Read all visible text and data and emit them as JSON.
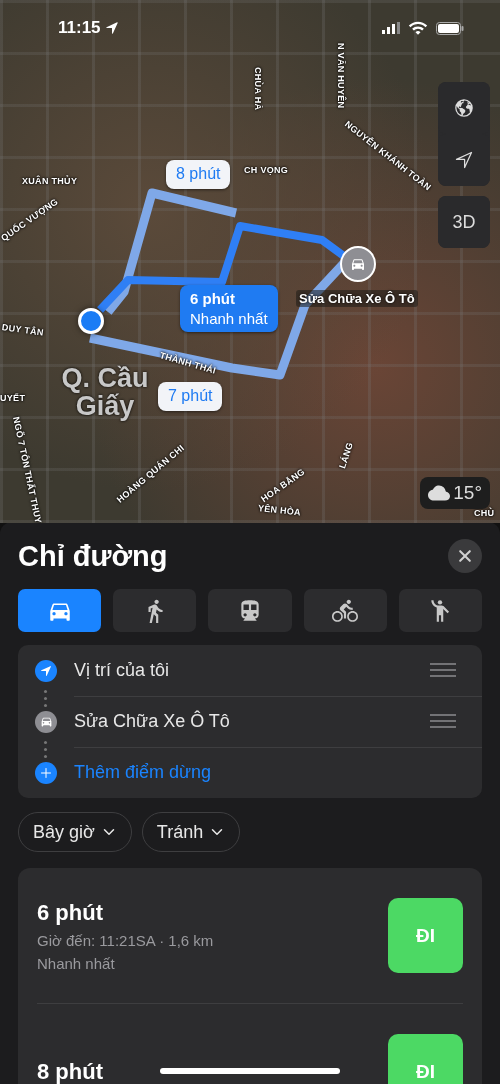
{
  "status_bar": {
    "time": "11:15"
  },
  "map": {
    "labels": [
      {
        "kind": "street",
        "text": "XUÂN THỦY"
      },
      {
        "kind": "street",
        "text": "QUỐC VƯỢNG"
      },
      {
        "kind": "street",
        "text": "CHÙA HÀ"
      },
      {
        "kind": "street",
        "text": "N VĂN HUYÊN"
      },
      {
        "kind": "street",
        "text": "NGUYỄN KHÁNH TOÀN"
      },
      {
        "kind": "street",
        "text": "CH VỌNG"
      },
      {
        "kind": "street",
        "text": "DUY TÂN"
      },
      {
        "kind": "street",
        "text": "THÀNH THÁI"
      },
      {
        "kind": "street",
        "text": "UYẾT"
      },
      {
        "kind": "district",
        "text": "Q. Cầu Giấy"
      },
      {
        "kind": "street",
        "text": "NGÕ 7 TÔN THẤT THUY"
      },
      {
        "kind": "street",
        "text": "HOÀNG QUÁN CHI"
      },
      {
        "kind": "street",
        "text": "HOA BẰNG"
      },
      {
        "kind": "street",
        "text": "LÁNG"
      },
      {
        "kind": "street",
        "text": "YÊN HÒA"
      },
      {
        "kind": "street",
        "text": "CHÙ"
      }
    ],
    "callouts": [
      {
        "text": "8 phút",
        "selected": false
      },
      {
        "text": "6 phút",
        "subtext": "Nhanh nhất",
        "selected": true
      },
      {
        "text": "7 phút",
        "selected": false
      }
    ],
    "destination": "Sửa Chữa Xe Ô Tô",
    "three_d": "3D",
    "weather": "15°"
  },
  "sheet": {
    "title": "Chỉ đường",
    "modes": [
      {
        "kind": "car",
        "selected": true
      },
      {
        "kind": "walk",
        "selected": false
      },
      {
        "kind": "transit",
        "selected": false
      },
      {
        "kind": "bike",
        "selected": false
      },
      {
        "kind": "ride",
        "selected": false
      }
    ],
    "waypoints": [
      {
        "kind": "origin",
        "label": "Vị trí của tôi"
      },
      {
        "kind": "destination",
        "label": "Sửa Chữa Xe Ô Tô"
      },
      {
        "kind": "add",
        "label": "Thêm điểm dừng"
      }
    ],
    "options": [
      "Bây giờ",
      "Tránh"
    ],
    "routes": [
      {
        "duration": "6 phút",
        "details": "Giờ đến: 11:21SA · 1,6 km",
        "note": "Nhanh nhất",
        "button": "ĐI"
      },
      {
        "duration": "8 phút",
        "button": "ĐI"
      }
    ]
  }
}
